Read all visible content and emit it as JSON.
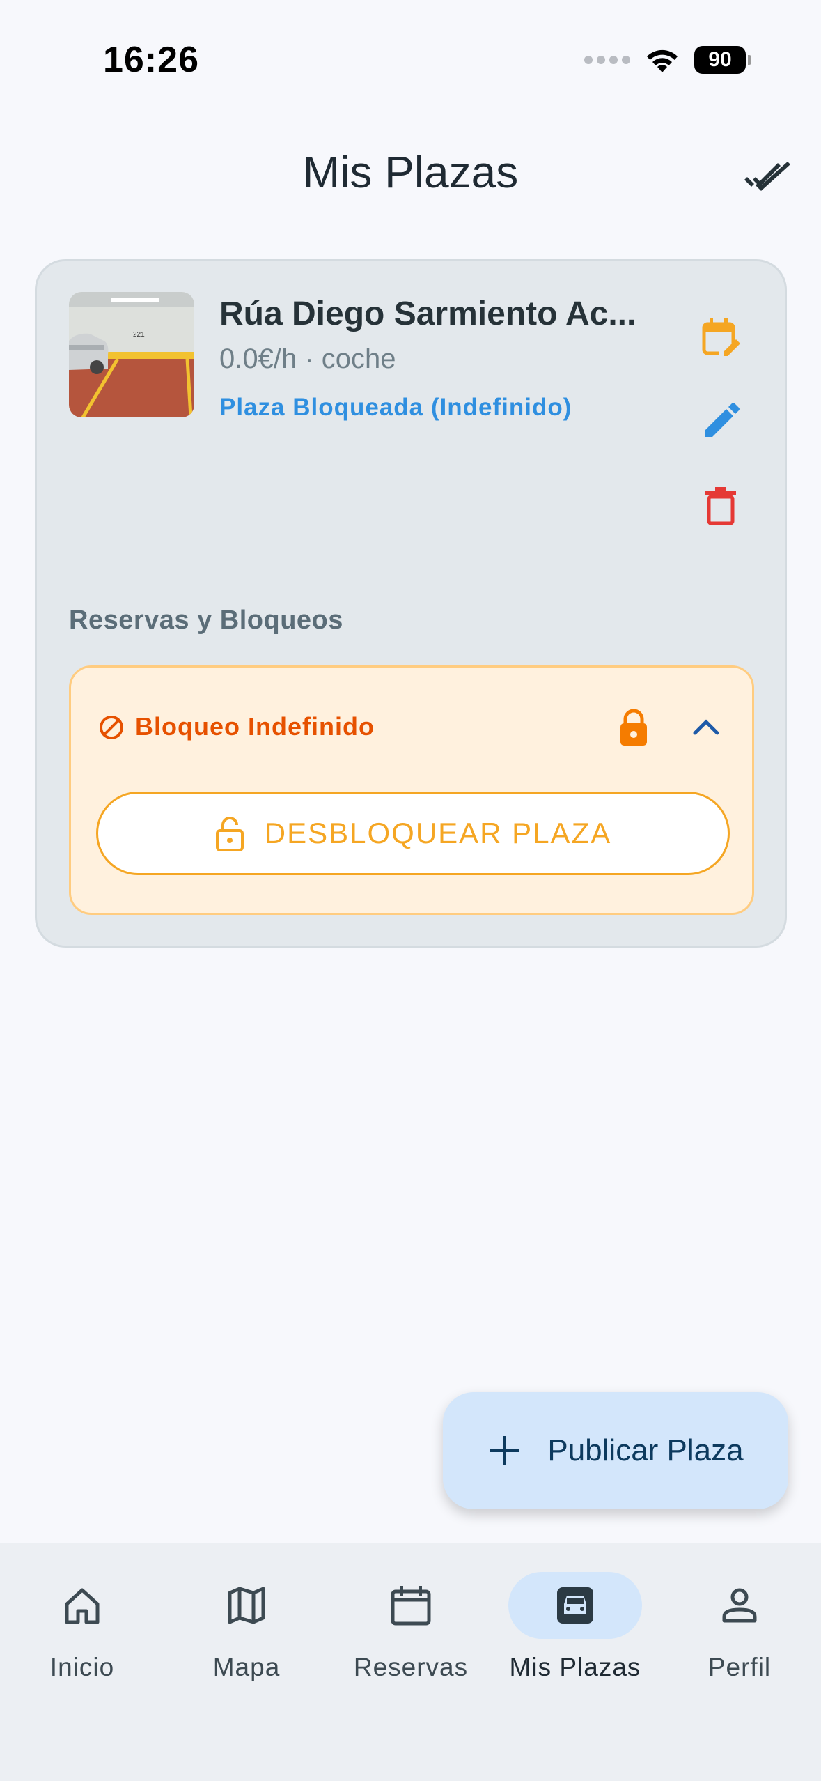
{
  "status_bar": {
    "time": "16:26",
    "battery": "90"
  },
  "header": {
    "title": "Mis Plazas",
    "action_icon": "done-all-icon"
  },
  "spot": {
    "title": "Rúa Diego Sarmiento Ac...",
    "subtitle": "0.0€/h · coche",
    "status": "Plaza Bloqueada (Indefinido)",
    "thumbnail_caption": "221",
    "actions": [
      {
        "icon": "calendar-edit-icon",
        "color": "#f5a623"
      },
      {
        "icon": "pencil-icon",
        "color": "#2f8fe0"
      },
      {
        "icon": "trash-icon",
        "color": "#e53935"
      }
    ]
  },
  "reservations": {
    "section_title": "Reservas y Bloqueos",
    "block": {
      "label": "Bloqueo Indefinido",
      "button_label": "DESBLOQUEAR PLAZA"
    }
  },
  "fab": {
    "label": "Publicar Plaza"
  },
  "nav": {
    "items": [
      {
        "label": "Inicio",
        "icon": "home-icon"
      },
      {
        "label": "Mapa",
        "icon": "map-icon"
      },
      {
        "label": "Reservas",
        "icon": "calendar-icon"
      },
      {
        "label": "Mis Plazas",
        "icon": "car-icon",
        "active": true
      },
      {
        "label": "Perfil",
        "icon": "person-icon"
      }
    ]
  },
  "colors": {
    "accent": "#2f8fe0",
    "warning": "#f5a623",
    "danger": "#e53935",
    "block_text": "#e65100"
  }
}
